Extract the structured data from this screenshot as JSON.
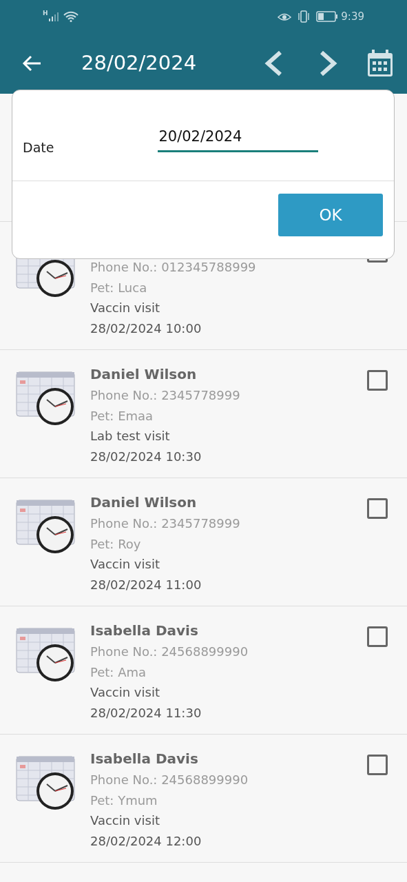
{
  "status_bar": {
    "network": "H",
    "time": "9:39"
  },
  "header": {
    "title": "28/02/2024"
  },
  "dialog": {
    "label": "Date",
    "value": "20/02/2024",
    "button": "OK"
  },
  "appointments": [
    {
      "phone": "Phone No.: 012345788999",
      "pet": "Pet: Luca",
      "visit": "Vaccin visit",
      "datetime": "28/02/2024 10:00",
      "checked": false
    },
    {
      "name": "Daniel Wilson",
      "phone": "Phone No.: 2345778999",
      "pet": "Pet: Emaa",
      "visit": "Lab test visit",
      "datetime": "28/02/2024 10:30",
      "checked": false
    },
    {
      "name": "Daniel Wilson",
      "phone": "Phone No.: 2345778999",
      "pet": "Pet: Roy",
      "visit": "Vaccin visit",
      "datetime": "28/02/2024 11:00",
      "checked": false
    },
    {
      "name": "Isabella Davis",
      "phone": "Phone No.: 24568899990",
      "pet": "Pet: Ama",
      "visit": "Vaccin visit",
      "datetime": "28/02/2024 11:30",
      "checked": false
    },
    {
      "name": "Isabella Davis",
      "phone": "Phone No.: 24568899990",
      "pet": "Pet: Ymum",
      "visit": "Vaccin visit",
      "datetime": "28/02/2024 12:00",
      "checked": false
    }
  ]
}
